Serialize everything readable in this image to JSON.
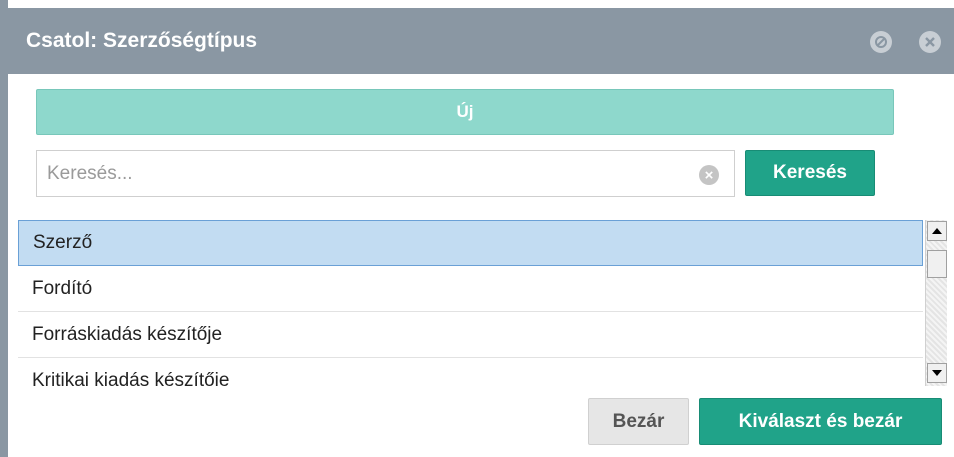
{
  "dialog": {
    "title": "Csatol: Szerzőségtípus",
    "title_buttons": [
      {
        "icon": "block-icon"
      },
      {
        "icon": "close-icon"
      }
    ]
  },
  "toolbar": {
    "new_label": "Új"
  },
  "search": {
    "placeholder": "Keresés...",
    "value": "",
    "button_label": "Keresés"
  },
  "list": {
    "items": [
      {
        "label": "Szerző",
        "selected": true
      },
      {
        "label": "Fordító",
        "selected": false
      },
      {
        "label": "Forráskiadás készítője",
        "selected": false
      },
      {
        "label": "Kritikai kiadás készítője",
        "selected": false
      }
    ]
  },
  "footer": {
    "close_label": "Bezár",
    "select_close_label": "Kiválaszt és bezár"
  },
  "colors": {
    "titlebar": "#8a97a3",
    "primary": "#20a389",
    "new_button": "#8ed8cc",
    "selected_row": "#c2dcf2"
  }
}
